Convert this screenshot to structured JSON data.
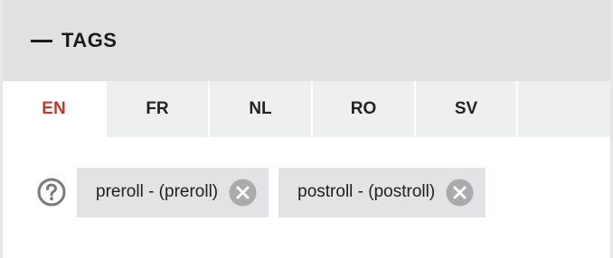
{
  "panel": {
    "title": "TAGS",
    "collapse_icon": "minus-icon"
  },
  "tabs": [
    {
      "label": "EN",
      "active": true
    },
    {
      "label": "FR",
      "active": false
    },
    {
      "label": "NL",
      "active": false
    },
    {
      "label": "RO",
      "active": false
    },
    {
      "label": "SV",
      "active": false
    }
  ],
  "tags": {
    "help_icon": "question-circle-icon",
    "items": [
      {
        "label": "preroll - (preroll)",
        "remove_icon": "close-circle-icon"
      },
      {
        "label": "postroll - (postroll)",
        "remove_icon": "close-circle-icon"
      }
    ]
  },
  "colors": {
    "header_bg": "#dfe1e2",
    "tab_bg": "#eef0f0",
    "active_tab_text": "#c0392b",
    "tag_bg": "#e2e3e4",
    "remove_icon": "#a9abad",
    "help_icon": "#7a7a7a"
  }
}
